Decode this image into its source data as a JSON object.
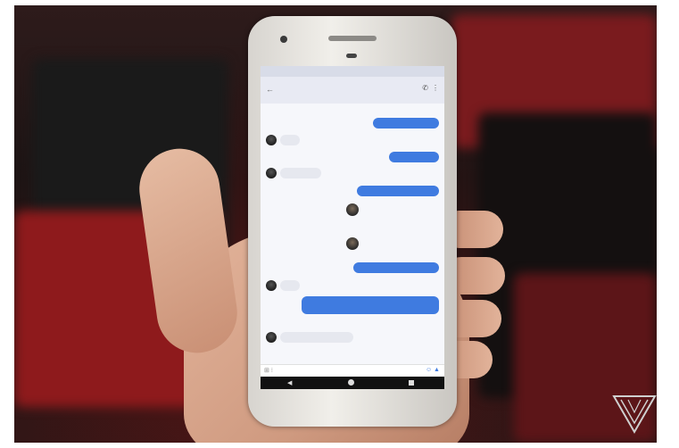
{
  "watermark_icon": "verge-triangle-logo-icon",
  "colors": {
    "bubble_outgoing": "#3f7be0",
    "bubble_incoming": "#e6e8ef",
    "screen_bg": "#f6f7fb"
  },
  "icons": [
    "back-arrow-icon",
    "phone-icon",
    "more-vert-icon",
    "attach-icon",
    "send-icon",
    "nav-back-icon",
    "nav-home-icon",
    "nav-recents-icon"
  ]
}
